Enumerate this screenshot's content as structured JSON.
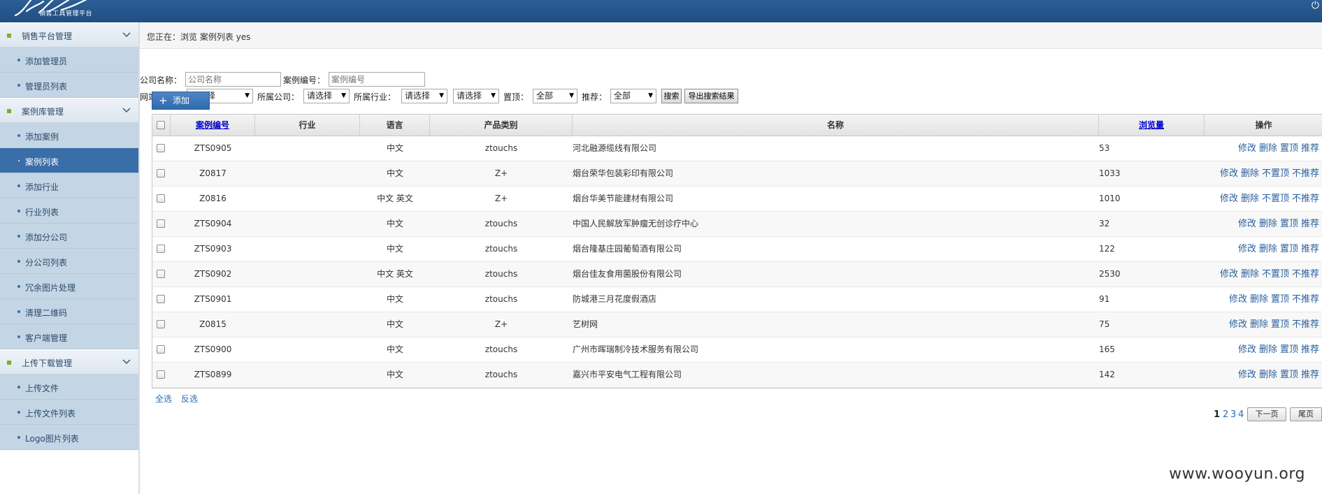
{
  "header": {
    "logo_sub": "销售工具管理平台",
    "right_icon": "power-icon"
  },
  "sidebar": {
    "groups": [
      {
        "label": "销售平台管理",
        "items": [
          "添加管理员",
          "管理员列表"
        ]
      },
      {
        "label": "案例库管理",
        "items": [
          "添加案例",
          "案例列表",
          "添加行业",
          "行业列表",
          "添加分公司",
          "分公司列表",
          "冗余图片处理",
          "清理二维码",
          "客户端管理"
        ]
      },
      {
        "label": "上传下载管理",
        "items": [
          "上传文件",
          "上传文件列表",
          "Logo图片列表"
        ]
      }
    ],
    "active_item": "案例列表"
  },
  "breadcrumb": "您正在：浏览 案例列表 yes",
  "filters": {
    "company_label": "公司名称：",
    "company_placeholder": "公司名称",
    "case_no_label": "案例编号：",
    "case_no_placeholder": "案例编号",
    "site_type_label": "网站类型：",
    "site_type_value": "请选择",
    "branch_label": "所属公司：",
    "branch_value": "请选择",
    "industry_label": "所属行业：",
    "industry_value": "请选择",
    "extra_value": "请选择",
    "top_label": "置顶：",
    "top_value": "全部",
    "recommend_label": "推荐：",
    "recommend_value": "全部",
    "search_btn": "搜索",
    "export_btn": "导出搜索结果"
  },
  "add_button": "添加",
  "table": {
    "headers": [
      "案例编号",
      "行业",
      "语言",
      "产品类别",
      "名称",
      "浏览量",
      "操作"
    ],
    "rows": [
      {
        "code": "ZTS0905",
        "industry": "",
        "lang": "中文",
        "category": "ztouchs",
        "name": "河北融源缆线有限公司",
        "views": "53",
        "ops": "修改 删除 置顶 推荐"
      },
      {
        "code": "Z0817",
        "industry": "",
        "lang": "中文",
        "category": "Z+",
        "name": "烟台荣华包装彩印有限公司",
        "views": "1033",
        "ops": "修改 删除 不置顶 不推荐"
      },
      {
        "code": "Z0816",
        "industry": "",
        "lang": "中文 英文",
        "category": "Z+",
        "name": "烟台华美节能建材有限公司",
        "views": "1010",
        "ops": "修改 删除 不置顶 不推荐"
      },
      {
        "code": "ZTS0904",
        "industry": "",
        "lang": "中文",
        "category": "ztouchs",
        "name": "中国人民解放军肿瘤无创诊疗中心",
        "views": "32",
        "ops": "修改 删除 置顶 推荐"
      },
      {
        "code": "ZTS0903",
        "industry": "",
        "lang": "中文",
        "category": "ztouchs",
        "name": "烟台隆基庄园葡萄酒有限公司",
        "views": "122",
        "ops": "修改 删除 置顶 推荐"
      },
      {
        "code": "ZTS0902",
        "industry": "",
        "lang": "中文 英文",
        "category": "ztouchs",
        "name": "烟台佳友食用菌股份有限公司",
        "views": "2530",
        "ops": "修改 删除 不置顶 不推荐"
      },
      {
        "code": "ZTS0901",
        "industry": "",
        "lang": "中文",
        "category": "ztouchs",
        "name": "防城港三月花度假酒店",
        "views": "91",
        "ops": "修改 删除 置顶 不推荐"
      },
      {
        "code": "Z0815",
        "industry": "",
        "lang": "中文",
        "category": "Z+",
        "name": "艺树网",
        "views": "75",
        "ops": "修改 删除 置顶 不推荐"
      },
      {
        "code": "ZTS0900",
        "industry": "",
        "lang": "中文",
        "category": "ztouchs",
        "name": "广州市晖瑞制冷技术服务有限公司",
        "views": "165",
        "ops": "修改 删除 置顶 推荐"
      },
      {
        "code": "ZTS0899",
        "industry": "",
        "lang": "中文",
        "category": "ztouchs",
        "name": "嘉兴市平安电气工程有限公司",
        "views": "142",
        "ops": "修改 删除 置顶 推荐"
      }
    ]
  },
  "bulk": {
    "select_all": "全选",
    "invert": "反选"
  },
  "pager": {
    "current": "1",
    "pages": [
      "2",
      "3",
      "4"
    ],
    "next": "下一页",
    "last": "尾页"
  },
  "watermark": "www.wooyun.org"
}
